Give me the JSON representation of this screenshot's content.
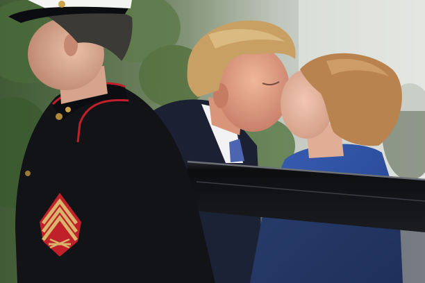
{
  "photo": {
    "colors": {
      "foliage": "#4f6b3e",
      "backdrop": "#e6e8e4",
      "uniform": "#121317",
      "trim": "#c0202a",
      "chevron": "#d9b56b",
      "suit_dark": "#1b2033",
      "suit_blue": "#2c4ea0",
      "hair_blond": "#c9a064",
      "hair_auburn": "#b8834f",
      "skin": "#e2a88d",
      "car": "#15171a"
    },
    "subjects": [
      "marine-guard",
      "man-in-dark-suit",
      "woman-in-blue-jacket"
    ],
    "objects": [
      "sergeant-chevron-patch",
      "limousine-door",
      "white-cap",
      "blue-tie"
    ]
  }
}
